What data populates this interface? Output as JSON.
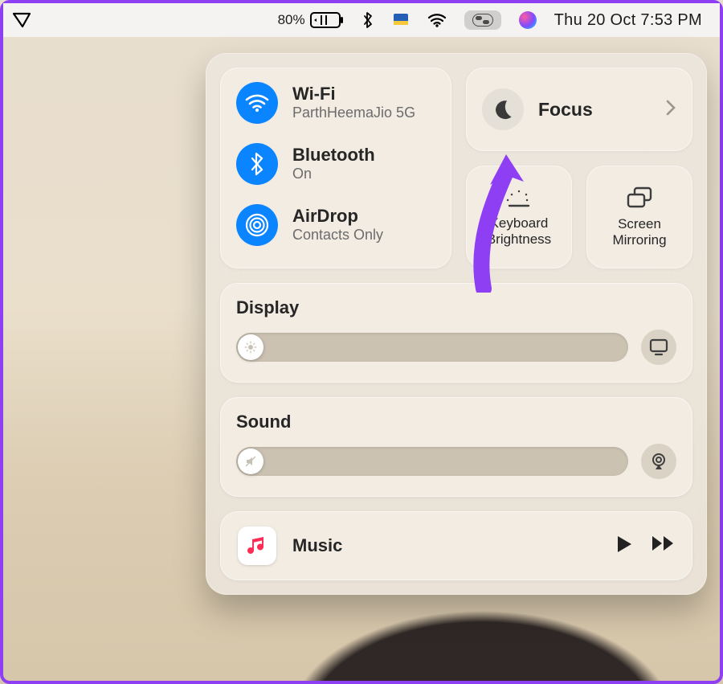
{
  "menubar": {
    "battery_pct": "80%",
    "datetime": "Thu 20 Oct  7:53 PM"
  },
  "controlCenter": {
    "wifi": {
      "title": "Wi-Fi",
      "subtitle": "ParthHeemaJio 5G"
    },
    "bluetooth": {
      "title": "Bluetooth",
      "subtitle": "On"
    },
    "airdrop": {
      "title": "AirDrop",
      "subtitle": "Contacts Only"
    },
    "focus": {
      "label": "Focus"
    },
    "keyboardBrightness": {
      "line1": "Keyboard",
      "line2": "Brightness"
    },
    "screenMirroring": {
      "line1": "Screen",
      "line2": "Mirroring"
    },
    "display": {
      "title": "Display"
    },
    "sound": {
      "title": "Sound"
    },
    "music": {
      "label": "Music"
    }
  }
}
